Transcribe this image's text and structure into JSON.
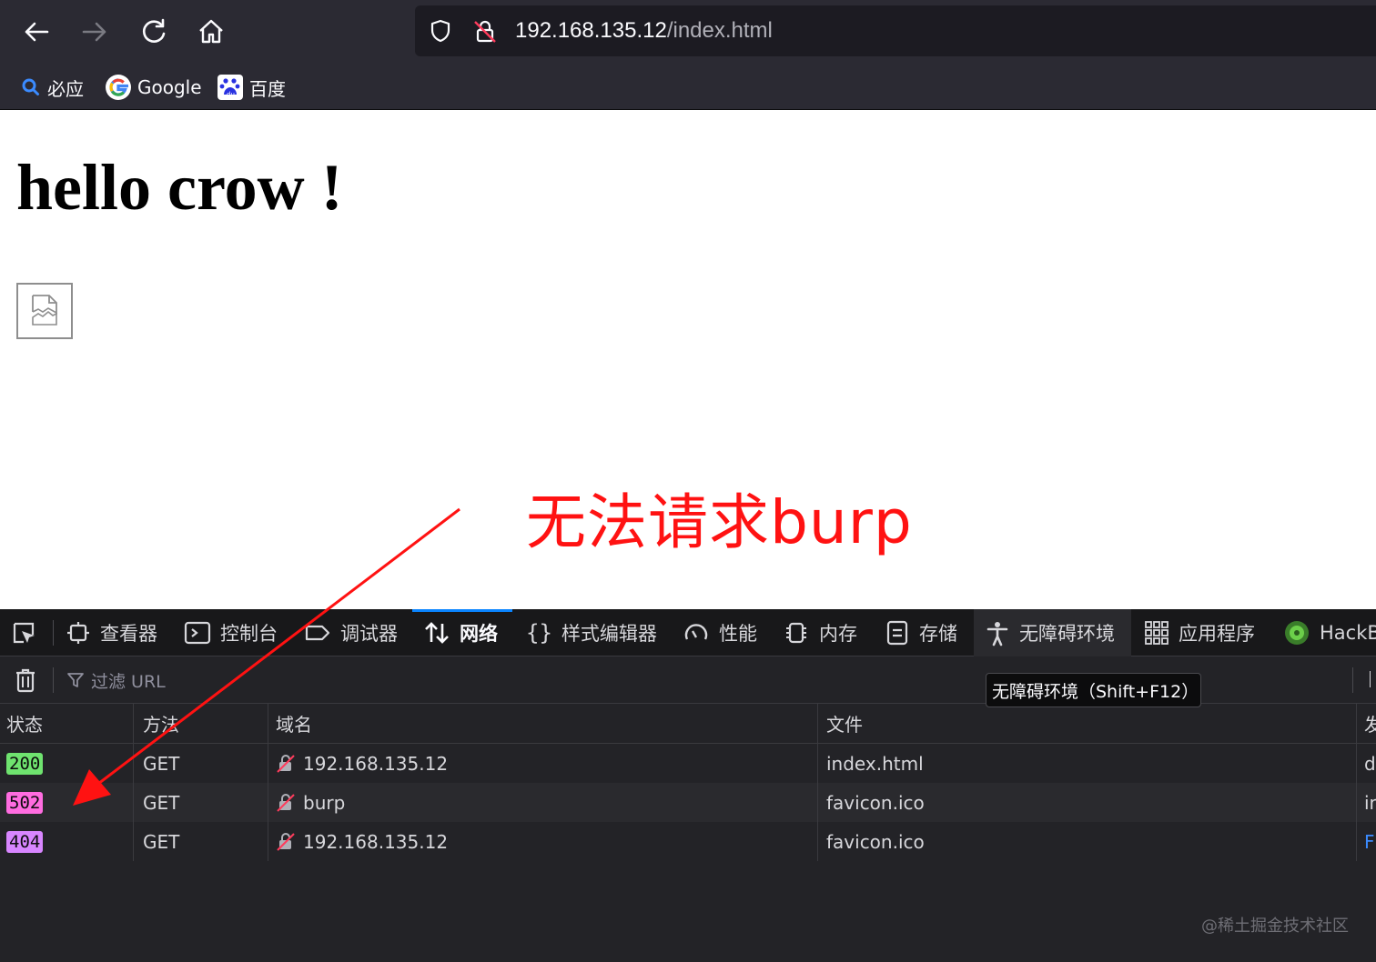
{
  "browser": {
    "url_host": "192.168.135.12",
    "url_path": "/index.html",
    "bookmarks": [
      {
        "label": "必应",
        "icon": "bing-search-icon"
      },
      {
        "label": "Google",
        "icon": "google-icon"
      },
      {
        "label": "百度",
        "icon": "baidu-icon"
      }
    ]
  },
  "page": {
    "heading": "hello crow !",
    "annotation": "无法请求burp"
  },
  "devtools": {
    "tabs": [
      {
        "label": "查看器",
        "icon": "inspector-icon"
      },
      {
        "label": "控制台",
        "icon": "console-icon"
      },
      {
        "label": "调试器",
        "icon": "debugger-icon"
      },
      {
        "label": "网络",
        "icon": "network-icon",
        "active": true
      },
      {
        "label": "样式编辑器",
        "icon": "style-editor-icon"
      },
      {
        "label": "性能",
        "icon": "performance-icon"
      },
      {
        "label": "内存",
        "icon": "memory-icon"
      },
      {
        "label": "存储",
        "icon": "storage-icon"
      },
      {
        "label": "无障碍环境",
        "icon": "accessibility-icon"
      },
      {
        "label": "应用程序",
        "icon": "application-icon"
      },
      {
        "label": "HackB",
        "icon": "hackbar-icon"
      }
    ],
    "filter_placeholder": "过滤 URL",
    "tooltip": "无障碍环境（Shift+F12）",
    "columns": [
      "状态",
      "方法",
      "域名",
      "文件",
      "发"
    ],
    "rows": [
      {
        "status": "200",
        "status_color": "#6fe36f",
        "method": "GET",
        "domain": "192.168.135.12",
        "file": "index.html",
        "extra": "d"
      },
      {
        "status": "502",
        "status_color": "#ff6ce0",
        "method": "GET",
        "domain": "burp",
        "file": "favicon.ico",
        "extra": "in"
      },
      {
        "status": "404",
        "status_color": "#d886ff",
        "method": "GET",
        "domain": "192.168.135.12",
        "file": "favicon.ico",
        "extra": "F"
      }
    ]
  },
  "watermark": "@稀土掘金技术社区",
  "colors": {
    "annotation": "#ff1212",
    "accent": "#0a84ff",
    "chrome_bg": "#2b2a33"
  }
}
